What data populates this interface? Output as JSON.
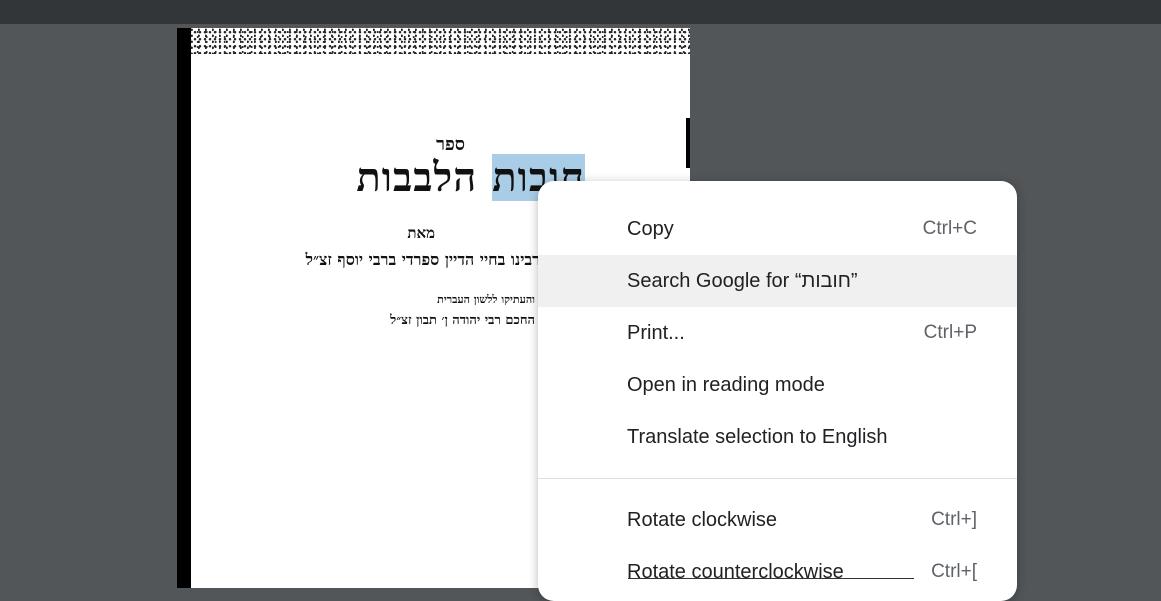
{
  "document": {
    "sefer": "ספר",
    "title_highlight": "חובות",
    "title_rest": "הלבבות",
    "meet": "מאת",
    "author": "רבינו בחיי הדיין ספרדי ברבי יוסף זצ״ל",
    "translated_line": "והעתיקו ללשון העברית",
    "translator": "החכם רבי יהודה ן׳ תבון זצ״ל"
  },
  "context_menu": {
    "items": [
      {
        "label": "Copy",
        "shortcut": "Ctrl+C"
      },
      {
        "label": "Search Google for “חובות”",
        "shortcut": ""
      },
      {
        "label": "Print...",
        "shortcut": "Ctrl+P"
      },
      {
        "label": "Open in reading mode",
        "shortcut": ""
      },
      {
        "label": "Translate selection to English",
        "shortcut": ""
      },
      {
        "label": "Rotate clockwise",
        "shortcut": "Ctrl+]"
      },
      {
        "label": "Rotate counterclockwise",
        "shortcut": "Ctrl+["
      }
    ]
  }
}
